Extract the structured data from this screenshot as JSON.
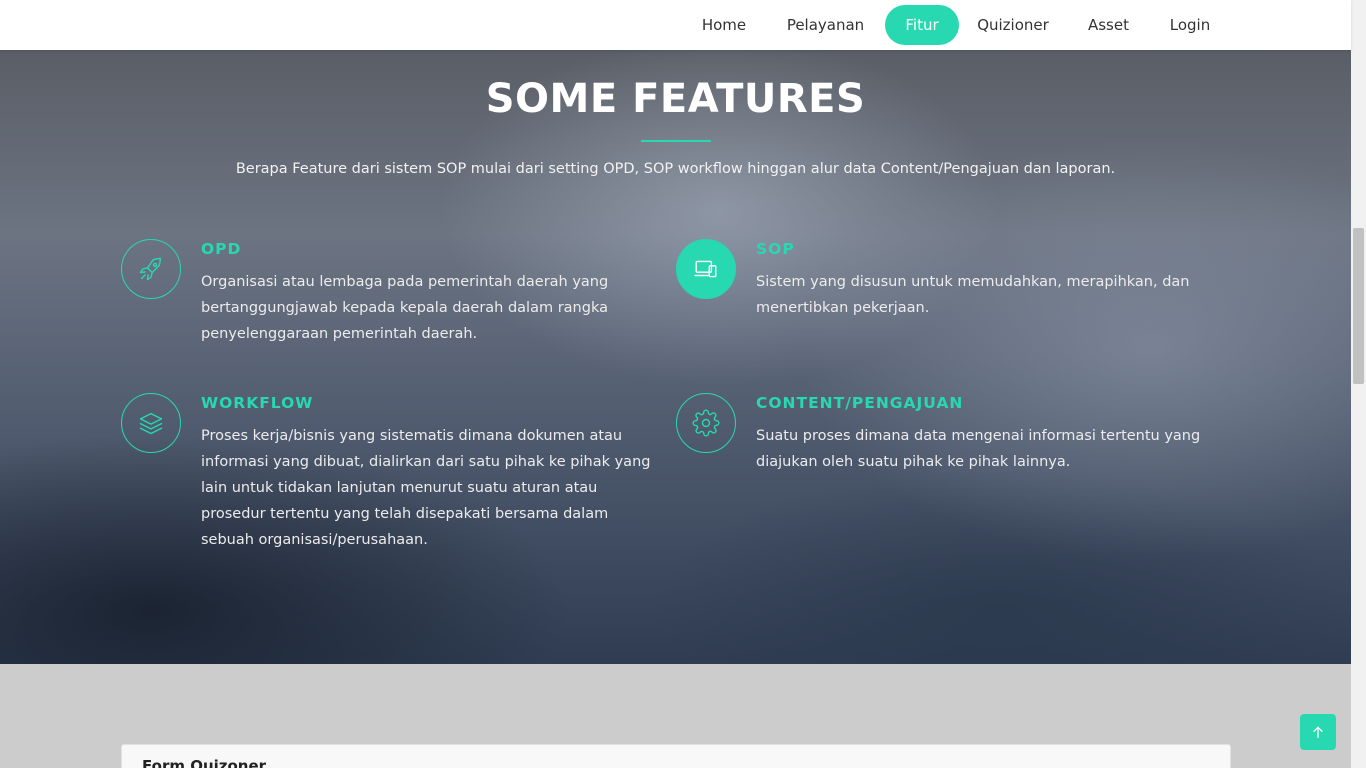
{
  "nav": {
    "items": [
      {
        "label": "Home",
        "active": false
      },
      {
        "label": "Pelayanan",
        "active": false
      },
      {
        "label": "Fitur",
        "active": true
      },
      {
        "label": "Quizioner",
        "active": false
      },
      {
        "label": "Asset",
        "active": false
      },
      {
        "label": "Login",
        "active": false
      }
    ]
  },
  "hero": {
    "title": "SOME FEATURES",
    "subtitle": "Berapa Feature dari sistem SOP mulai dari setting OPD, SOP workflow hinggan alur data Content/Pengajuan dan laporan."
  },
  "features": [
    {
      "title": "OPD",
      "icon": "rocket-icon",
      "description": "Organisasi atau lembaga pada pemerintah daerah yang bertanggungjawab kepada kepala daerah dalam rangka penyelenggaraan pemerintah daerah."
    },
    {
      "title": "SOP",
      "icon": "devices-icon",
      "description": "Sistem yang disusun untuk memudahkan, merapihkan, dan menertibkan pekerjaan."
    },
    {
      "title": "WORKFLOW",
      "icon": "layers-icon",
      "description": "Proses kerja/bisnis yang sistematis dimana dokumen atau informasi yang dibuat, dialirkan dari satu pihak ke pihak yang lain untuk tidakan lanjutan menurut suatu aturan atau prosedur tertentu yang telah disepakati bersama dalam sebuah organisasi/perusahaan."
    },
    {
      "title": "CONTENT/PENGAJUAN",
      "icon": "gear-icon",
      "description": "Suatu proses dimana data mengenai informasi tertentu yang diajukan oleh suatu pihak ke pihak lainnya."
    }
  ],
  "form": {
    "title": "Form Quizoner"
  },
  "colors": {
    "accent": "#27d8b1"
  }
}
